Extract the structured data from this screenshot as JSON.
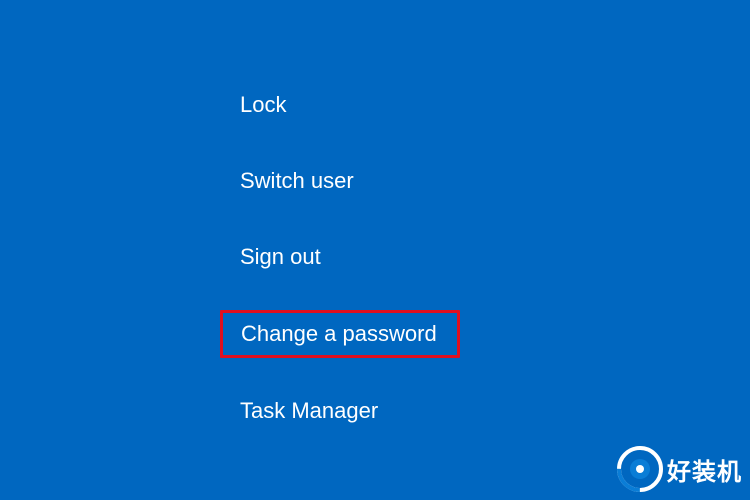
{
  "menu": {
    "items": [
      {
        "label": "Lock",
        "highlighted": false
      },
      {
        "label": "Switch user",
        "highlighted": false
      },
      {
        "label": "Sign out",
        "highlighted": false
      },
      {
        "label": "Change a password",
        "highlighted": true
      },
      {
        "label": "Task Manager",
        "highlighted": false
      }
    ]
  },
  "watermark": {
    "text": "好装机"
  },
  "colors": {
    "background": "#0067c0",
    "highlight_border": "#e01020",
    "watermark_accent": "#0a7dd6"
  }
}
